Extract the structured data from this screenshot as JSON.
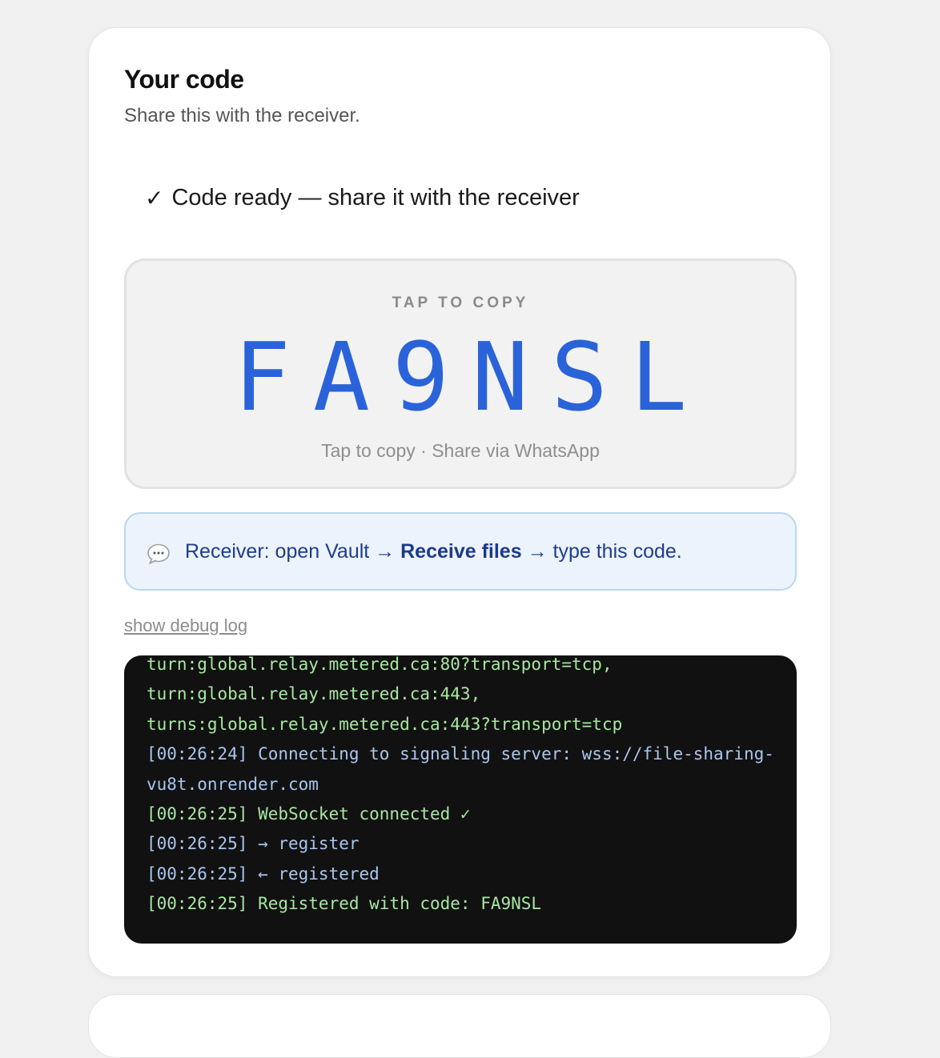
{
  "title": "Your code",
  "subtitle": "Share this with the receiver.",
  "status": {
    "check": "✓",
    "text": "Code ready — share it with the receiver"
  },
  "code_box": {
    "caption": "TAP TO COPY",
    "code": "FA9NSL",
    "hint": "Tap to copy · Share via WhatsApp"
  },
  "hint": {
    "icon": "speech-bubble-icon",
    "prefix": "Receiver: open Vault → ",
    "bold": "Receive files",
    "suffix": " → type this code."
  },
  "debug_toggle": "show debug log",
  "log": [
    {
      "text": "turn:global.relay.metered.ca:80?transport=tcp,",
      "color": "green"
    },
    {
      "text": "turn:global.relay.metered.ca:443,",
      "color": "green"
    },
    {
      "text": "turns:global.relay.metered.ca:443?transport=tcp",
      "color": "green"
    },
    {
      "text": "[00:26:24] Connecting to signaling server: wss://file-sharing-vu8t.onrender.com",
      "color": "blue"
    },
    {
      "text": "[00:26:25] WebSocket connected ✓",
      "color": "green"
    },
    {
      "text": "[00:26:25] → register",
      "color": "blue"
    },
    {
      "text": "[00:26:25] ← registered",
      "color": "blue"
    },
    {
      "text": "[00:26:25] Registered with code: FA9NSL",
      "color": "green"
    }
  ],
  "colors": {
    "accent": "#2a63d9",
    "log_green": "#a7e8a0",
    "log_blue": "#a9c6f0"
  }
}
